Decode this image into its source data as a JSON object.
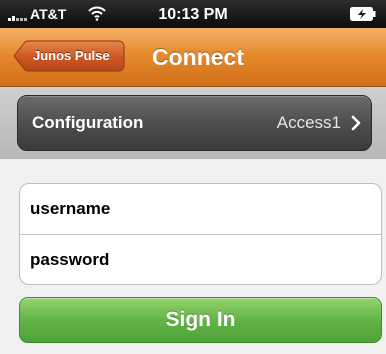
{
  "status_bar": {
    "carrier": "AT&T",
    "time": "10:13 PM",
    "icons": [
      "signal-icon",
      "wifi-icon",
      "battery-icon"
    ]
  },
  "nav": {
    "back_label": "Junos Pulse",
    "title": "Connect",
    "colors": {
      "bar": "#e58a2d",
      "back_button": "#c8531e"
    }
  },
  "configuration": {
    "label": "Configuration",
    "value": "Access1",
    "icon": "chevron-right-icon"
  },
  "login": {
    "username_placeholder": "username",
    "password_placeholder": "password",
    "sign_in_label": "Sign In",
    "colors": {
      "sign_in": "#63b446"
    }
  }
}
